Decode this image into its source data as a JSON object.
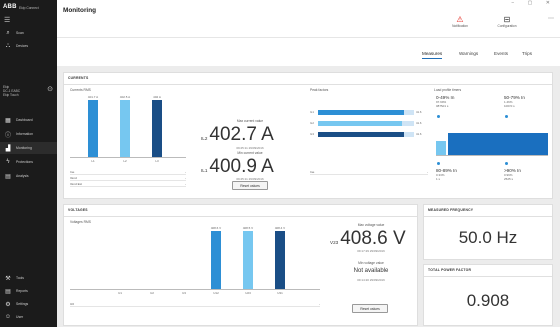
{
  "app": {
    "logo": "ABB",
    "logo_sub": "Ekip Connect",
    "window_controls": "− ▢ ✕"
  },
  "sidebar": {
    "top_items": [
      {
        "label": "Scan",
        "icon": "search-icon"
      },
      {
        "label": "Devices",
        "icon": "network-icon"
      }
    ],
    "device": {
      "line1": "Ekip",
      "line2": "DC-1 EABC",
      "line3": "Ekip Touch"
    },
    "items": [
      {
        "label": "Dashboard",
        "icon": "dashboard-icon"
      },
      {
        "label": "Information",
        "icon": "info-icon"
      },
      {
        "label": "Monitoring",
        "icon": "monitoring-icon"
      },
      {
        "label": "Protections",
        "icon": "protection-icon"
      },
      {
        "label": "Analysis",
        "icon": "analysis-icon"
      }
    ],
    "bottom_items": [
      {
        "label": "Tools",
        "icon": "tools-icon"
      },
      {
        "label": "Reports",
        "icon": "reports-icon"
      },
      {
        "label": "Settings",
        "icon": "settings-icon"
      },
      {
        "label": "User",
        "icon": "user-icon"
      }
    ]
  },
  "header": {
    "title": "Monitoring",
    "notification_label": "Notification",
    "configuration_label": "Configuration"
  },
  "tabs": [
    "Measures",
    "Warnings",
    "Events",
    "Trips"
  ],
  "currents": {
    "title": "CURRENTS",
    "rms_label": "Currents RMS",
    "bars": [
      {
        "name": "L1",
        "value": 401.7,
        "label": "401.7 A",
        "color": "#2d8fd5"
      },
      {
        "name": "L2",
        "value": 402.5,
        "label": "402.5 A",
        "color": "#76c7f0"
      },
      {
        "name": "L3",
        "value": 402.7,
        "label": "402 A",
        "color": "#1a4e86"
      }
    ],
    "rows": [
      {
        "label": "Ine",
        "value": "-"
      },
      {
        "label": "IGnd",
        "value": "-"
      },
      {
        "label": "IGnd Ext",
        "value": "-"
      }
    ],
    "max_label": "Max current value",
    "max_prefix": "IL2",
    "max_value": "402.7 A",
    "max_ts": "09:25:11 29/09/2016",
    "min_label": "Min current value",
    "min_prefix": "IL1",
    "min_value": "400.9 A",
    "min_ts": "09:25:11 29/09/2016",
    "reset_label": "Reset values",
    "peak_label": "Peak factors",
    "peak_rows": [
      {
        "name": "IL1",
        "value": 0.9,
        "label": "41.6"
      },
      {
        "name": "IL2",
        "value": 0.88,
        "label": "41.6"
      },
      {
        "name": "IL3",
        "value": 0.9,
        "label": "41.6"
      }
    ],
    "peak_ne": "Ine",
    "peak_ne_value": "-",
    "load_label": "Load profile timers",
    "load": [
      {
        "range": "0-49% In",
        "pct": "97.99%",
        "time": "0875d1 s"
      },
      {
        "range": "50-79% In",
        "pct": "1.46%",
        "time": "1007d s"
      },
      {
        "range": "80-89% In",
        "pct": "0.33%",
        "time": "1 s"
      },
      {
        "range": ">90% In",
        "pct": "0.99%",
        "time": "2525 s"
      }
    ]
  },
  "voltages": {
    "title": "VOLTAGES",
    "rms_label": "Voltages RMS",
    "bars": [
      {
        "name": "U1",
        "value": 0,
        "label": "",
        "color": "#2d8fd5"
      },
      {
        "name": "U2",
        "value": 0,
        "label": "",
        "color": "#76c7f0"
      },
      {
        "name": "U3",
        "value": 0,
        "label": "",
        "color": "#1a4e86"
      },
      {
        "name": "U12",
        "value": 408.6,
        "label": "408.6 V",
        "color": "#2d8fd5"
      },
      {
        "name": "U23",
        "value": 408.5,
        "label": "408.5 V",
        "color": "#76c7f0"
      },
      {
        "name": "U31",
        "value": 408.4,
        "label": "408.4 V",
        "color": "#1a4e86"
      }
    ],
    "row_label": "U0",
    "row_value": "-",
    "max_label": "Max voltage value",
    "max_prefix": "V23",
    "max_value": "408.6 V",
    "max_ts": "09:17:29 29/09/2016",
    "min_label": "Min voltage value",
    "min_value": "Not available",
    "min_ts": "09:14:20 29/09/2016",
    "reset_label": "Reset values"
  },
  "frequency": {
    "title": "MEASURED FREQUENCY",
    "value": "50.0 Hz"
  },
  "power_factor": {
    "title": "TOTAL POWER FACTOR",
    "value": "0.908"
  }
}
